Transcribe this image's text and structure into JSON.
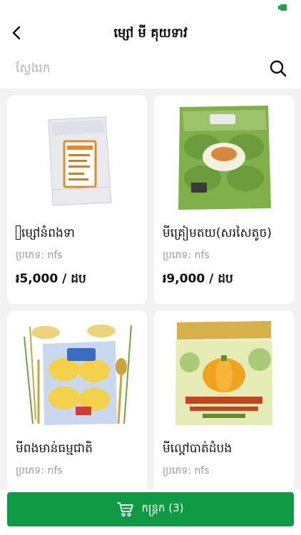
{
  "header": {
    "title": "ម្សៅ មី គុយទាវ",
    "back_icon": "chevron-left-icon"
  },
  "search": {
    "placeholder": "ស្វែងរក",
    "icon": "search-icon"
  },
  "products": [
    {
      "name": "ម្សៅនំពងទា",
      "type": "ប្រភេទ: nfs",
      "price": "៛5,000 / ដប"
    },
    {
      "name": "មីគ្រៀមតយ(សរសៃតូច)",
      "type": "ប្រភេទ: nfs",
      "price": "៛9,000 / ដប"
    },
    {
      "name": "មីពងមាន់ធម្មជាតិ",
      "type": "ប្រភេទ: nfs",
      "price": ""
    },
    {
      "name": "មីល្ពៅបាត់ដំបង",
      "type": "ប្រភេទ: nfs",
      "price": ""
    }
  ],
  "cart": {
    "label": "កន្ត្រក (3)",
    "icon": "cart-icon"
  },
  "colors": {
    "accent": "#119a44",
    "background": "#f2f2f2",
    "muted_text": "#9a9a9a"
  }
}
